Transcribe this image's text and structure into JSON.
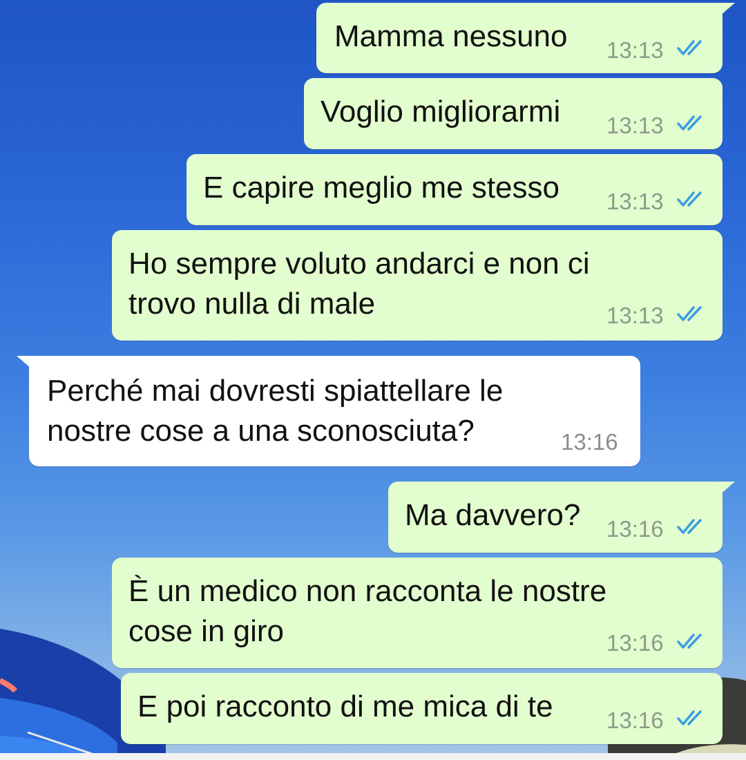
{
  "messages": [
    {
      "text": "Mamma nessuno",
      "time": "13:13"
    },
    {
      "text": "Voglio migliorarmi",
      "time": "13:13"
    },
    {
      "text": "E capire meglio me stesso",
      "time": "13:13"
    },
    {
      "text": "Ho sempre voluto andarci e non ci\ntrovo nulla di male",
      "time": "13:13"
    },
    {
      "text": "Perché mai dovresti spiattellare le\nnostre cose a una sconosciuta?",
      "time": "13:16"
    },
    {
      "text": "Ma davvero?",
      "time": "13:16"
    },
    {
      "text": "È un medico non racconta le nostre\ncose in giro",
      "time": "13:16"
    },
    {
      "text": "E poi racconto di me mica di te",
      "time": "13:16"
    }
  ],
  "colors": {
    "outgoing_bubble": "#e2fdce",
    "incoming_bubble": "#ffffff",
    "read_ticks": "#3a9ee0"
  },
  "icons": {
    "read_status": "double-check-icon"
  }
}
